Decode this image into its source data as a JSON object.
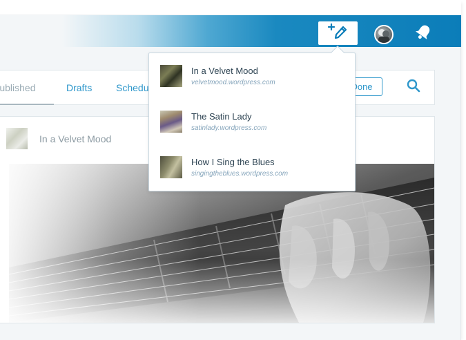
{
  "header": {
    "write_icon": "write-post-plus-pencil-icon",
    "avatar_icon": "user-avatar",
    "notifications_icon": "notifications-bell-icon"
  },
  "tabs": [
    {
      "label": "Published",
      "active": true
    },
    {
      "label": "Drafts",
      "active": false
    },
    {
      "label": "Scheduled",
      "active": false
    }
  ],
  "toolbar": {
    "done_label": "Done",
    "search_icon": "search-icon"
  },
  "post": {
    "site_name": "In a Velvet Mood"
  },
  "site_picker": {
    "sites": [
      {
        "name": "In a Velvet Mood",
        "url": "velvetmood.wordpress.com"
      },
      {
        "name": "The Satin Lady",
        "url": "satinlady.wordpress.com"
      },
      {
        "name": "How I Sing the Blues",
        "url": "singingtheblues.wordpress.com"
      }
    ]
  },
  "colors": {
    "masterbar": "#0b7db9",
    "link": "#2e97cb",
    "muted": "#8d9ba3"
  }
}
